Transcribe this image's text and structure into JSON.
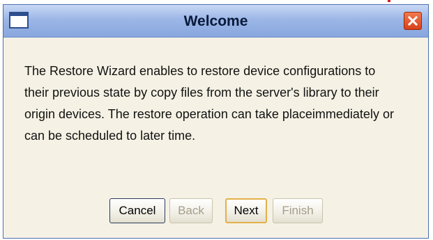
{
  "dialog": {
    "title": "Welcome",
    "message": "The Restore Wizard enables to restore device configurations to their previous state by copy files from the server's library to their origin devices. The restore operation can take placeimmediately or can be scheduled to later time."
  },
  "buttons": {
    "cancel": {
      "label": "Cancel",
      "enabled": true
    },
    "back": {
      "label": "Back",
      "enabled": false
    },
    "next": {
      "label": "Next",
      "enabled": true,
      "focused": true
    },
    "finish": {
      "label": "Finish",
      "enabled": false
    }
  },
  "icons": {
    "window_icon": "window-icon",
    "close_icon": "close-icon"
  },
  "colors": {
    "titlebar": "#9cb6e6",
    "dialog_background": "#f5f2e5",
    "close_button": "#d8411a",
    "focus_border": "#e3b04a",
    "disabled_text": "#a39e8a"
  }
}
